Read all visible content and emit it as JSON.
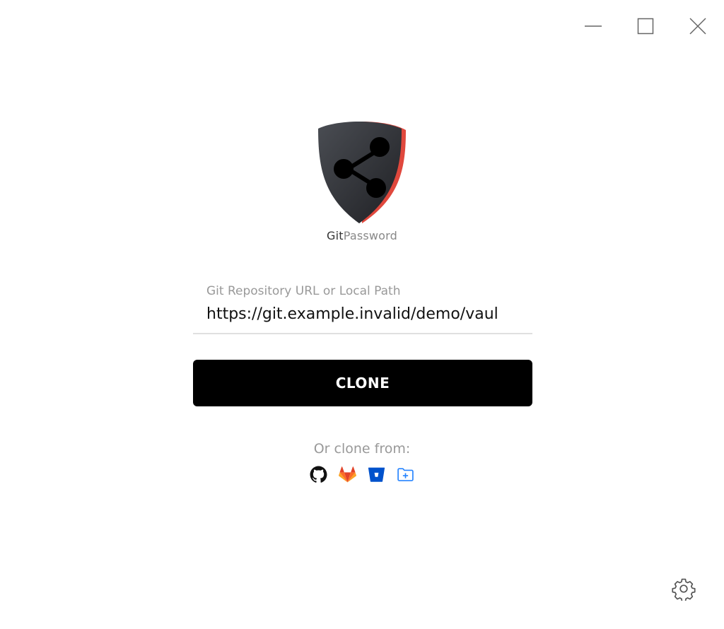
{
  "window": {
    "controls": [
      "minimize",
      "maximize",
      "close"
    ]
  },
  "logo": {
    "text_git": "Git",
    "text_password": "Password",
    "icon": "share-shield-icon",
    "shield_color": "#2f3136",
    "accent_color": "#e0483d"
  },
  "repo_field": {
    "label": "Git Repository URL or Local Path",
    "value": "https://git.example.invalid/demo/vaul"
  },
  "clone_button": {
    "label": "CLONE",
    "background": "#000000"
  },
  "alt_sources": {
    "label": "Or clone from:",
    "providers": [
      {
        "name": "github",
        "icon": "github-icon",
        "color": "#111111"
      },
      {
        "name": "gitlab",
        "icon": "gitlab-icon",
        "color": "#fc6d26"
      },
      {
        "name": "bitbucket",
        "icon": "bitbucket-icon",
        "color": "#0052cc"
      },
      {
        "name": "local-folder",
        "icon": "folder-plus-icon",
        "color": "#2684ff"
      }
    ]
  },
  "settings": {
    "icon": "gear-icon"
  }
}
